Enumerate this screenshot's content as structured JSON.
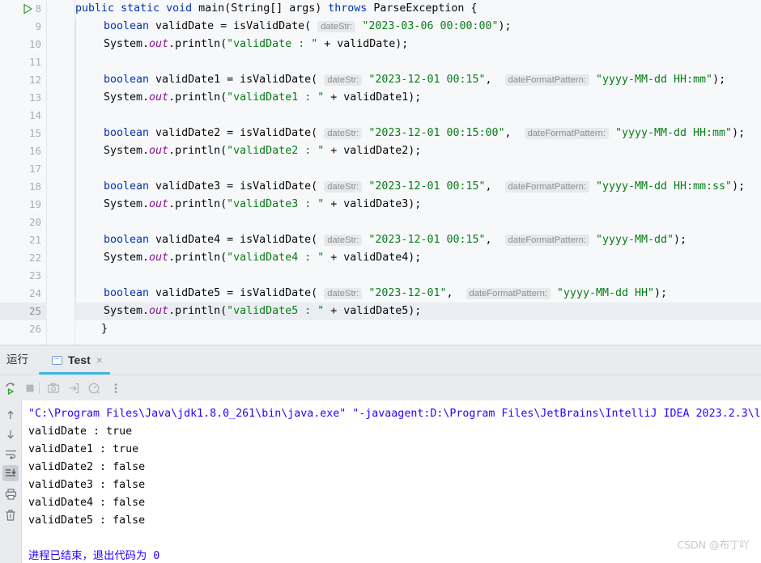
{
  "editor": {
    "first_line_number": 8,
    "current_line_number": 25,
    "lines": [
      {
        "num": "8",
        "indent": 0,
        "run_marker": true,
        "tokens": [
          {
            "t": "kw",
            "v": "public"
          },
          {
            "t": "plain",
            "v": " "
          },
          {
            "t": "kw",
            "v": "static"
          },
          {
            "t": "plain",
            "v": " "
          },
          {
            "t": "kw",
            "v": "void"
          },
          {
            "t": "plain",
            "v": " main(String[] args) "
          },
          {
            "t": "kw",
            "v": "throws"
          },
          {
            "t": "plain",
            "v": " ParseException {"
          }
        ]
      },
      {
        "num": "9",
        "indent": 1,
        "tokens": [
          {
            "t": "kw",
            "v": "boolean"
          },
          {
            "t": "plain",
            "v": " validDate = isValidDate( "
          },
          {
            "t": "hint",
            "v": "dateStr:"
          },
          {
            "t": "plain",
            "v": " "
          },
          {
            "t": "str",
            "v": "\"2023-03-06 00:00:00\""
          },
          {
            "t": "plain",
            "v": ");"
          }
        ]
      },
      {
        "num": "10",
        "indent": 1,
        "tokens": [
          {
            "t": "plain",
            "v": "System."
          },
          {
            "t": "fld",
            "v": "out"
          },
          {
            "t": "plain",
            "v": ".println("
          },
          {
            "t": "str",
            "v": "\"validDate : \""
          },
          {
            "t": "plain",
            "v": " + validDate);"
          }
        ]
      },
      {
        "num": "11",
        "indent": 1,
        "tokens": []
      },
      {
        "num": "12",
        "indent": 1,
        "tokens": [
          {
            "t": "kw",
            "v": "boolean"
          },
          {
            "t": "plain",
            "v": " validDate1 = isValidDate( "
          },
          {
            "t": "hint",
            "v": "dateStr:"
          },
          {
            "t": "plain",
            "v": " "
          },
          {
            "t": "str",
            "v": "\"2023-12-01 00:15\""
          },
          {
            "t": "plain",
            "v": ",  "
          },
          {
            "t": "hint",
            "v": "dateFormatPattern:"
          },
          {
            "t": "plain",
            "v": " "
          },
          {
            "t": "str",
            "v": "\"yyyy-MM-dd HH:mm\""
          },
          {
            "t": "plain",
            "v": ");"
          }
        ]
      },
      {
        "num": "13",
        "indent": 1,
        "tokens": [
          {
            "t": "plain",
            "v": "System."
          },
          {
            "t": "fld",
            "v": "out"
          },
          {
            "t": "plain",
            "v": ".println("
          },
          {
            "t": "str",
            "v": "\"validDate1 : \""
          },
          {
            "t": "plain",
            "v": " + validDate1);"
          }
        ]
      },
      {
        "num": "14",
        "indent": 1,
        "tokens": []
      },
      {
        "num": "15",
        "indent": 1,
        "tokens": [
          {
            "t": "kw",
            "v": "boolean"
          },
          {
            "t": "plain",
            "v": " validDate2 = isValidDate( "
          },
          {
            "t": "hint",
            "v": "dateStr:"
          },
          {
            "t": "plain",
            "v": " "
          },
          {
            "t": "str",
            "v": "\"2023-12-01 00:15:00\""
          },
          {
            "t": "plain",
            "v": ",  "
          },
          {
            "t": "hint",
            "v": "dateFormatPattern:"
          },
          {
            "t": "plain",
            "v": " "
          },
          {
            "t": "str",
            "v": "\"yyyy-MM-dd HH:mm\""
          },
          {
            "t": "plain",
            "v": ");"
          }
        ]
      },
      {
        "num": "16",
        "indent": 1,
        "tokens": [
          {
            "t": "plain",
            "v": "System."
          },
          {
            "t": "fld",
            "v": "out"
          },
          {
            "t": "plain",
            "v": ".println("
          },
          {
            "t": "str",
            "v": "\"validDate2 : \""
          },
          {
            "t": "plain",
            "v": " + validDate2);"
          }
        ]
      },
      {
        "num": "17",
        "indent": 1,
        "tokens": []
      },
      {
        "num": "18",
        "indent": 1,
        "tokens": [
          {
            "t": "kw",
            "v": "boolean"
          },
          {
            "t": "plain",
            "v": " validDate3 = isValidDate( "
          },
          {
            "t": "hint",
            "v": "dateStr:"
          },
          {
            "t": "plain",
            "v": " "
          },
          {
            "t": "str",
            "v": "\"2023-12-01 00:15\""
          },
          {
            "t": "plain",
            "v": ",  "
          },
          {
            "t": "hint",
            "v": "dateFormatPattern:"
          },
          {
            "t": "plain",
            "v": " "
          },
          {
            "t": "str",
            "v": "\"yyyy-MM-dd HH:mm:ss\""
          },
          {
            "t": "plain",
            "v": ");"
          }
        ]
      },
      {
        "num": "19",
        "indent": 1,
        "tokens": [
          {
            "t": "plain",
            "v": "System."
          },
          {
            "t": "fld",
            "v": "out"
          },
          {
            "t": "plain",
            "v": ".println("
          },
          {
            "t": "str",
            "v": "\"validDate3 : \""
          },
          {
            "t": "plain",
            "v": " + validDate3);"
          }
        ]
      },
      {
        "num": "20",
        "indent": 1,
        "tokens": []
      },
      {
        "num": "21",
        "indent": 1,
        "tokens": [
          {
            "t": "kw",
            "v": "boolean"
          },
          {
            "t": "plain",
            "v": " validDate4 = isValidDate( "
          },
          {
            "t": "hint",
            "v": "dateStr:"
          },
          {
            "t": "plain",
            "v": " "
          },
          {
            "t": "str",
            "v": "\"2023-12-01 00:15\""
          },
          {
            "t": "plain",
            "v": ",  "
          },
          {
            "t": "hint",
            "v": "dateFormatPattern:"
          },
          {
            "t": "plain",
            "v": " "
          },
          {
            "t": "str",
            "v": "\"yyyy-MM-dd\""
          },
          {
            "t": "plain",
            "v": ");"
          }
        ]
      },
      {
        "num": "22",
        "indent": 1,
        "tokens": [
          {
            "t": "plain",
            "v": "System."
          },
          {
            "t": "fld",
            "v": "out"
          },
          {
            "t": "plain",
            "v": ".println("
          },
          {
            "t": "str",
            "v": "\"validDate4 : \""
          },
          {
            "t": "plain",
            "v": " + validDate4);"
          }
        ]
      },
      {
        "num": "23",
        "indent": 1,
        "tokens": []
      },
      {
        "num": "24",
        "indent": 1,
        "tokens": [
          {
            "t": "kw",
            "v": "boolean"
          },
          {
            "t": "plain",
            "v": " validDate5 = isValidDate( "
          },
          {
            "t": "hint",
            "v": "dateStr:"
          },
          {
            "t": "plain",
            "v": " "
          },
          {
            "t": "str",
            "v": "\"2023-12-01\""
          },
          {
            "t": "plain",
            "v": ",  "
          },
          {
            "t": "hint",
            "v": "dateFormatPattern:"
          },
          {
            "t": "plain",
            "v": " "
          },
          {
            "t": "str",
            "v": "\"yyyy-MM-dd HH\""
          },
          {
            "t": "plain",
            "v": ");"
          }
        ]
      },
      {
        "num": "25",
        "indent": 1,
        "highlight": true,
        "tokens": [
          {
            "t": "plain",
            "v": "System."
          },
          {
            "t": "fld",
            "v": "out"
          },
          {
            "t": "plain",
            "v": ".println("
          },
          {
            "t": "str",
            "v": "\"validDate5 : \""
          },
          {
            "t": "plain",
            "v": " + validDate5);"
          }
        ]
      },
      {
        "num": "26",
        "indent": 0,
        "tokens": [
          {
            "t": "plain",
            "v": "    }"
          }
        ]
      }
    ]
  },
  "run_window": {
    "title": "运行",
    "tab": {
      "label": "Test",
      "icon": "class-file-icon",
      "close": "×"
    },
    "toolbar": [
      {
        "name": "rerun-button",
        "icon": "rerun-icon"
      },
      {
        "name": "stop-button",
        "icon": "stop-icon"
      },
      {
        "name": "screenshot-button",
        "icon": "camera-icon"
      },
      {
        "name": "thread-dump-button",
        "icon": "export-icon"
      },
      {
        "name": "profiler-button",
        "icon": "gauge-icon"
      },
      {
        "name": "more-options-button",
        "icon": "more-vertical-icon"
      }
    ],
    "console_gutter": [
      {
        "name": "scroll-up-button",
        "icon": "arrow-up-icon",
        "active": false
      },
      {
        "name": "scroll-down-button",
        "icon": "arrow-down-icon",
        "active": false
      },
      {
        "name": "soft-wrap-button",
        "icon": "soft-wrap-icon",
        "active": false
      },
      {
        "name": "scroll-to-end-button",
        "icon": "scroll-to-end-icon",
        "active": true
      },
      {
        "name": "print-button",
        "icon": "print-icon",
        "active": false
      },
      {
        "name": "clear-all-button",
        "icon": "trash-icon",
        "active": false
      }
    ],
    "console": {
      "lines": [
        {
          "cls": "co-cmd",
          "text": "\"C:\\Program Files\\Java\\jdk1.8.0_261\\bin\\java.exe\" \"-javaagent:D:\\Program Files\\JetBrains\\IntelliJ IDEA 2023.2.3\\l"
        },
        {
          "cls": "",
          "text": "validDate : true"
        },
        {
          "cls": "",
          "text": "validDate1 : true"
        },
        {
          "cls": "",
          "text": "validDate2 : false"
        },
        {
          "cls": "",
          "text": "validDate3 : false"
        },
        {
          "cls": "",
          "text": "validDate4 : false"
        },
        {
          "cls": "",
          "text": "validDate5 : false"
        },
        {
          "cls": "",
          "text": ""
        },
        {
          "cls": "co-exit",
          "text": "进程已结束，退出代码为 0"
        }
      ]
    }
  },
  "watermark": "CSDN @布丁吖",
  "colors": {
    "editor_bg": "#f7f8fa",
    "keyword": "#0033b3",
    "string": "#067d17",
    "field": "#871094",
    "hint_bg": "#e8e9eb",
    "hint_fg": "#8c8c8c",
    "current_line": "#eaeef2",
    "tab_accent": "#3ab9e3",
    "console_cmd": "#2a00ff",
    "panel_bg": "#e9ebee"
  }
}
